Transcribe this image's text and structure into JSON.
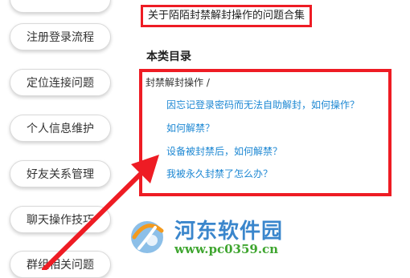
{
  "sidebar": {
    "items": [
      {
        "label": ""
      },
      {
        "label": "注册登录流程"
      },
      {
        "label": "定位连接问题"
      },
      {
        "label": "个人信息维护"
      },
      {
        "label": "好友关系管理"
      },
      {
        "label": "聊天操作技巧"
      },
      {
        "label": "群组相关问题"
      }
    ]
  },
  "main": {
    "title": "关于陌陌封禁解封操作的问题合集",
    "section_heading": "本类目录",
    "category_label": "封禁解封操作 /",
    "questions": [
      {
        "label": "因忘记登录密码而无法自助解封，如何操作？"
      },
      {
        "label": "如何解禁？"
      },
      {
        "label": "设备被封禁后，如何解禁？"
      },
      {
        "label": "我被永久封禁了怎么办？"
      }
    ]
  },
  "watermark": {
    "site_name": "河东软件园",
    "url": "www.pc0359.cn"
  },
  "colors": {
    "highlight_red": "#ee1c24",
    "link_blue": "#1e88d3",
    "watermark_blue": "#3a86cc",
    "watermark_green": "#3ea52f"
  }
}
